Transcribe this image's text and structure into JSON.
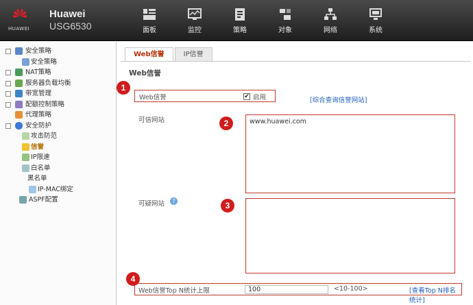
{
  "brand": {
    "logo_text": "HUAWEI",
    "name": "Huawei",
    "model": "USG6530"
  },
  "nav": [
    {
      "label": "面板",
      "icon": "dashboard-icon"
    },
    {
      "label": "监控",
      "icon": "monitor-icon"
    },
    {
      "label": "策略",
      "icon": "policy-icon"
    },
    {
      "label": "对象",
      "icon": "object-icon"
    },
    {
      "label": "网络",
      "icon": "network-icon"
    },
    {
      "label": "系统",
      "icon": "system-icon"
    }
  ],
  "sidebar": {
    "items": [
      {
        "label": "安全策略",
        "icon": "security-policy-icon"
      },
      {
        "label": "安全策略",
        "icon": "security-policy-leaf-icon"
      },
      {
        "label": "NAT策略",
        "icon": "nat-policy-icon"
      },
      {
        "label": "服务器负载均衡",
        "icon": "server-load-balance-icon"
      },
      {
        "label": "带宽管理",
        "icon": "bandwidth-icon"
      },
      {
        "label": "配额控制策略",
        "icon": "quota-icon"
      },
      {
        "label": "代理策略",
        "icon": "proxy-icon"
      },
      {
        "label": "安全防护",
        "icon": "security-protection-icon"
      },
      {
        "label": "攻击防范",
        "icon": "attack-defense-icon"
      },
      {
        "label": "信誉",
        "icon": "reputation-icon"
      },
      {
        "label": "IP限速",
        "icon": "ip-limit-icon"
      },
      {
        "label": "白名单",
        "icon": "whitelist-icon"
      },
      {
        "label": "黑名单",
        "icon": "blacklist-icon"
      },
      {
        "label": "IP-MAC绑定",
        "icon": "ip-mac-icon"
      },
      {
        "label": "ASPF配置",
        "icon": "aspf-icon"
      }
    ]
  },
  "tabs": [
    {
      "label": "Web信誉"
    },
    {
      "label": "IP信誉"
    }
  ],
  "section_title": "Web信誉",
  "web_reputation": {
    "label": "Web信誉",
    "enable_label": "启用",
    "enabled": true,
    "query_link": "[综合查询信誉网站]"
  },
  "trusted_sites": {
    "label": "可信网站",
    "value": "www.huawei.com"
  },
  "suspicious_sites": {
    "label": "可疑网站",
    "help_icon": "help-icon",
    "value": ""
  },
  "topn": {
    "label": "Web信誉Top N统计上限",
    "value": "100",
    "range": "<10-100>",
    "link": "[查看Top N排名统计]"
  },
  "markers": [
    "1",
    "2",
    "3",
    "4"
  ],
  "colors": {
    "accent_red": "#d01c1c",
    "link_blue": "#1f5fb8",
    "header_dark": "#2a2a2a"
  }
}
